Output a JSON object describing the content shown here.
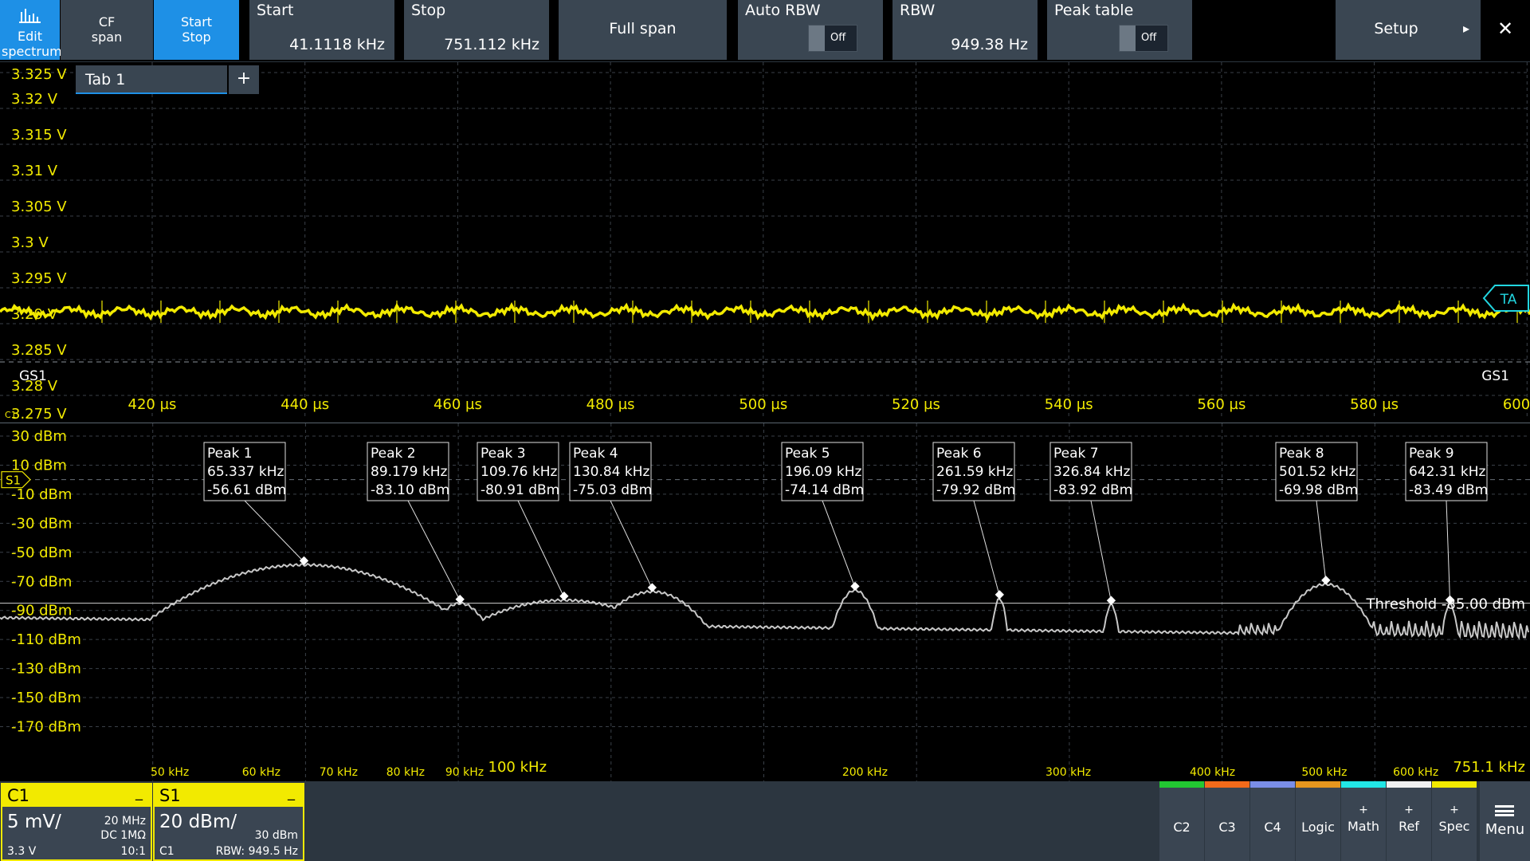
{
  "toolbar": {
    "edit_spectrum": "Edit spectrum",
    "cf_span": "CF span",
    "start_stop": "Start Stop",
    "start_label": "Start",
    "start_value": "41.1118 kHz",
    "stop_label": "Stop",
    "stop_value": "751.112 kHz",
    "full_span": "Full span",
    "auto_rbw_label": "Auto RBW",
    "auto_rbw_state": "Off",
    "rbw_label": "RBW",
    "rbw_value": "949.38 Hz",
    "peak_table_label": "Peak table",
    "peak_table_state": "Off",
    "setup": "Setup",
    "close": "✕"
  },
  "time_panel": {
    "tab_label": "Tab 1",
    "tab_add": "+",
    "y_labels": [
      "3.325 V",
      "3.32 V",
      "3.315 V",
      "3.31 V",
      "3.305 V",
      "3.3 V",
      "3.295 V",
      "3.29 V",
      "3.285 V",
      "3.28 V",
      "3.275 V"
    ],
    "x_labels": [
      "420 µs",
      "440 µs",
      "460 µs",
      "480 µs",
      "500 µs",
      "520 µs",
      "540 µs",
      "560 µs",
      "580 µs",
      "600 µs"
    ],
    "gate_left": "GS1",
    "gate_right": "GS1",
    "trigger_marker": "TA",
    "channel_marker": "C1",
    "trace_color": "#f2ea00"
  },
  "spec_panel": {
    "y_labels": [
      "30 dBm",
      "10 dBm",
      "-10 dBm",
      "-30 dBm",
      "-50 dBm",
      "-70 dBm",
      "-90 dBm",
      "-110 dBm",
      "-130 dBm",
      "-150 dBm",
      "-170 dBm"
    ],
    "x_labels": [
      "50 kHz",
      "60 kHz",
      "70 kHz",
      "80 kHz",
      "90 kHz",
      "100 kHz",
      "200 kHz",
      "300 kHz",
      "400 kHz",
      "500 kHz",
      "600 kHz",
      "751.1 kHz"
    ],
    "ref_marker": "S1",
    "threshold_label": "Threshold -85.00 dBm",
    "peaks": [
      {
        "name": "Peak 1",
        "freq": "65.337 kHz",
        "level": "-56.61 dBm"
      },
      {
        "name": "Peak 2",
        "freq": "89.179 kHz",
        "level": "-83.10 dBm"
      },
      {
        "name": "Peak 3",
        "freq": "109.76 kHz",
        "level": "-80.91 dBm"
      },
      {
        "name": "Peak 4",
        "freq": "130.84 kHz",
        "level": "-75.03 dBm"
      },
      {
        "name": "Peak 5",
        "freq": "196.09 kHz",
        "level": "-74.14 dBm"
      },
      {
        "name": "Peak 6",
        "freq": "261.59 kHz",
        "level": "-79.92 dBm"
      },
      {
        "name": "Peak 7",
        "freq": "326.84 kHz",
        "level": "-83.92 dBm"
      },
      {
        "name": "Peak 8",
        "freq": "501.52 kHz",
        "level": "-69.98 dBm"
      },
      {
        "name": "Peak 9",
        "freq": "642.31 kHz",
        "level": "-83.49 dBm"
      }
    ]
  },
  "status": {
    "c1": {
      "name": "C1",
      "minimize": "_",
      "scale": "5 mV/",
      "bw": "20 MHz",
      "coupling": "DC 1MΩ",
      "offset": "3.3 V",
      "probe": "10:1"
    },
    "s1": {
      "name": "S1",
      "minimize": "_",
      "scale": "20 dBm/",
      "ref": "30 dBm",
      "source": "C1",
      "rbw": "RBW: 949.5 Hz"
    },
    "buttons": [
      {
        "label": "C2",
        "color": "#22c832",
        "plus": ""
      },
      {
        "label": "C3",
        "color": "#f26a1a",
        "plus": ""
      },
      {
        "label": "C4",
        "color": "#7a8ee8",
        "plus": ""
      },
      {
        "label": "Logic",
        "color": "#e6961e",
        "plus": ""
      },
      {
        "label": "Math",
        "color": "#22e6e6",
        "plus": "+"
      },
      {
        "label": "Ref",
        "color": "#f0f0f0",
        "plus": "+"
      },
      {
        "label": "Spec",
        "color": "#f2ea00",
        "plus": "+"
      }
    ],
    "menu": "Menu"
  }
}
